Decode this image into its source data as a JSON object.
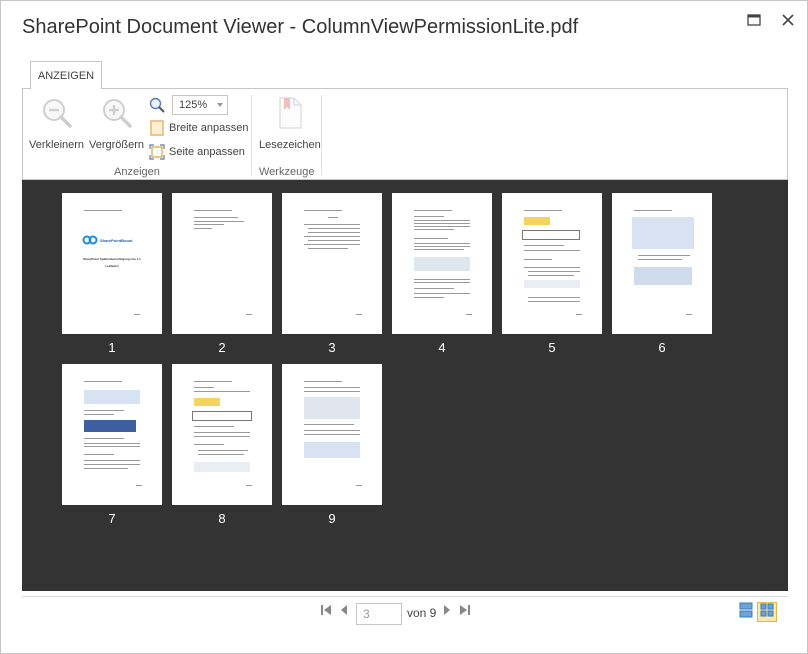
{
  "window": {
    "title": "SharePoint Document Viewer - ColumnViewPermissionLite.pdf",
    "maximize_icon": "maximize-icon",
    "close_icon": "close-icon"
  },
  "ribbon": {
    "tab_label": "ANZEIGEN",
    "zoom_out_label": "Verkleinern",
    "zoom_in_label": "Vergrößern",
    "zoom_value": "125%",
    "fit_width_label": "Breite anpassen",
    "fit_page_label": "Seite anpassen",
    "group_view_label": "Anzeigen",
    "bookmark_label": "Lesezeichen",
    "group_tools_label": "Werkzeuge"
  },
  "thumbnails": [
    {
      "number": "1"
    },
    {
      "number": "2"
    },
    {
      "number": "3"
    },
    {
      "number": "4"
    },
    {
      "number": "5"
    },
    {
      "number": "6"
    },
    {
      "number": "7"
    },
    {
      "number": "8"
    },
    {
      "number": "9"
    }
  ],
  "cover": {
    "logo_text": "SharePointBoost",
    "line1": "SharePoint Spaltenberechtigung Lite 1.1",
    "line2": "Leitfaden"
  },
  "pager": {
    "current_page_placeholder": "3",
    "of_label": "von 9"
  },
  "colors": {
    "viewer_bg": "#333333",
    "accent": "#0072c6",
    "active_view": "#fde8a8"
  }
}
